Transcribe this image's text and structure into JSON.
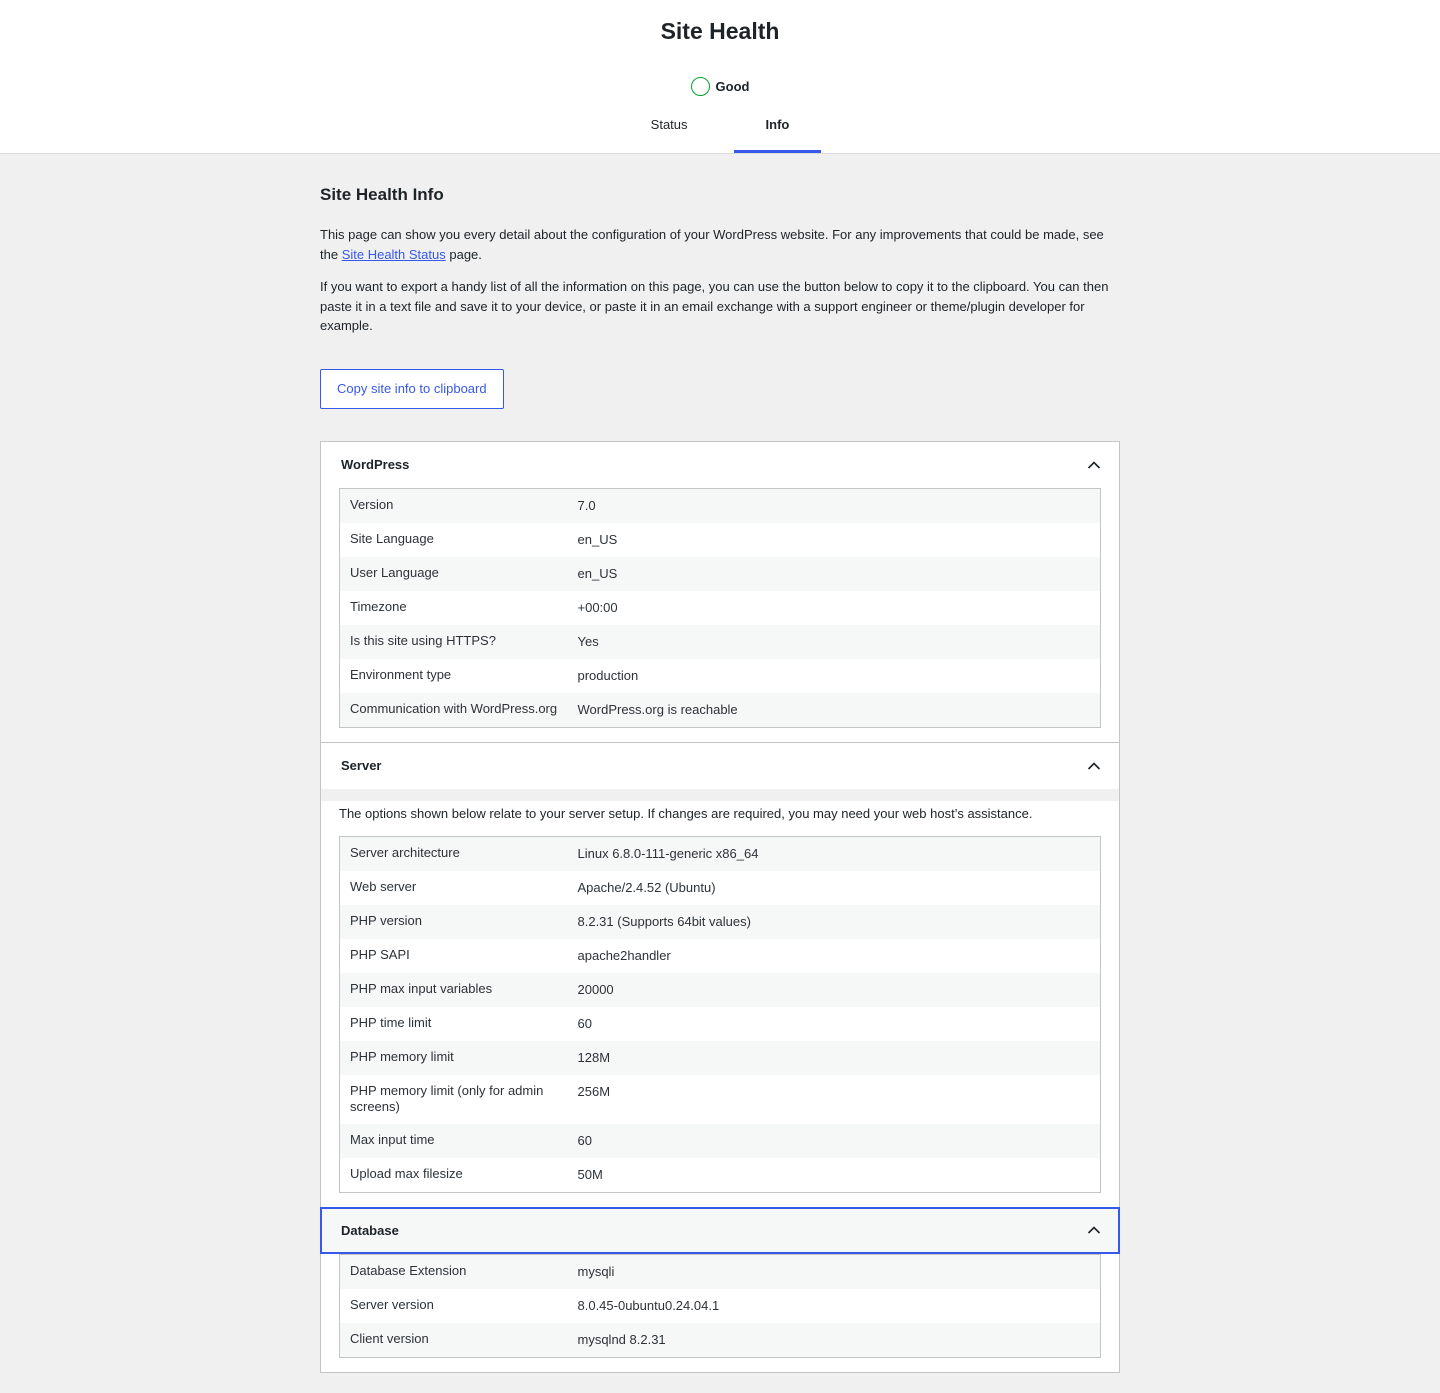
{
  "header": {
    "title": "Site Health",
    "status": "Good",
    "tabs": [
      {
        "label": "Status",
        "active": false
      },
      {
        "label": "Info",
        "active": true
      }
    ],
    "status_color": "#00a32a",
    "accent": "#3858e9"
  },
  "info": {
    "title": "Site Health Info",
    "para1_before": "This page can show you every detail about the configuration of your WordPress website. For any improvements that could be made, see the ",
    "para1_link": "Site Health Status",
    "para1_after": " page.",
    "para2": "If you want to export a handy list of all the information on this page, you can use the button below to copy it to the clipboard. You can then paste it in a text file and save it to your device, or paste it in an email exchange with a support engineer or theme/plugin developer for example.",
    "copy_button": "Copy site info to clipboard"
  },
  "sections": {
    "wordpress": {
      "title": "WordPress",
      "rows": [
        {
          "k": "Version",
          "v": "7.0"
        },
        {
          "k": "Site Language",
          "v": "en_US"
        },
        {
          "k": "User Language",
          "v": "en_US"
        },
        {
          "k": "Timezone",
          "v": "+00:00"
        },
        {
          "k": "Is this site using HTTPS?",
          "v": "Yes"
        },
        {
          "k": "Environment type",
          "v": "production"
        },
        {
          "k": "Communication with WordPress.org",
          "v": "WordPress.org is reachable"
        }
      ]
    },
    "server": {
      "title": "Server",
      "description": "The options shown below relate to your server setup. If changes are required, you may need your web host’s assistance.",
      "rows": [
        {
          "k": "Server architecture",
          "v": "Linux 6.8.0-111-generic x86_64"
        },
        {
          "k": "Web server",
          "v": "Apache/2.4.52 (Ubuntu)"
        },
        {
          "k": "PHP version",
          "v": "8.2.31 (Supports 64bit values)"
        },
        {
          "k": "PHP SAPI",
          "v": "apache2handler"
        },
        {
          "k": "PHP max input variables",
          "v": "20000"
        },
        {
          "k": "PHP time limit",
          "v": "60"
        },
        {
          "k": "PHP memory limit",
          "v": "128M"
        },
        {
          "k": "PHP memory limit (only for admin screens)",
          "v": "256M"
        },
        {
          "k": "Max input time",
          "v": "60"
        },
        {
          "k": "Upload max filesize",
          "v": "50M"
        }
      ]
    },
    "database": {
      "title": "Database",
      "rows": [
        {
          "k": "Database Extension",
          "v": "mysqli"
        },
        {
          "k": "Server version",
          "v": "8.0.45-0ubuntu0.24.04.1"
        },
        {
          "k": "Client version",
          "v": "mysqlnd 8.2.31"
        }
      ]
    }
  }
}
